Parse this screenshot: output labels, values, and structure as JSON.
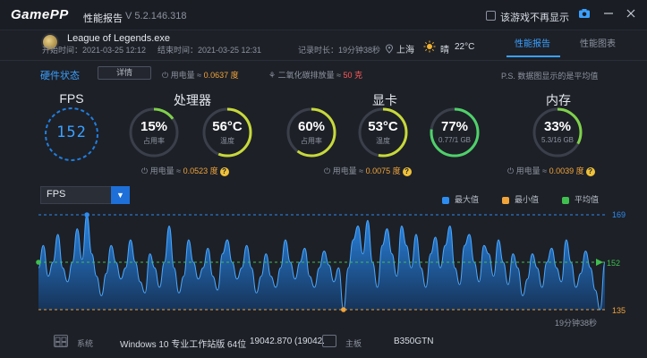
{
  "titlebar": {
    "logo": "GamePP",
    "title": "性能报告",
    "version": "V 5.2.146.318",
    "hide_checkbox_label": "该游戏不再显示"
  },
  "header": {
    "game_name": "League of Legends.exe",
    "start_time": "开始时间：2021-03-25 12:12",
    "end_time": "结束时间：2021-03-25 12:31",
    "duration": "记录时长：19分钟38秒",
    "city": "上海",
    "weather": "晴",
    "temperature": "22°C",
    "tabs": [
      {
        "label": "性能报告",
        "active": true
      },
      {
        "label": "性能图表",
        "active": false
      }
    ]
  },
  "hardware": {
    "status_label": "硬件状态",
    "detail_button": "详情",
    "power_prefix": "用电量 ≈ ",
    "power_value": "0.0637 度",
    "co2_prefix": "二氧化碳排放量 ≈ ",
    "co2_value": "50 克",
    "note": "P.S. 数据图显示的是平均值"
  },
  "fps": {
    "label": "FPS",
    "value": "152"
  },
  "cpu": {
    "label": "处理器",
    "gauges": [
      {
        "value": "15%",
        "sub": "占用率",
        "percent": 15,
        "color": "#7fd14a"
      },
      {
        "value": "56°C",
        "sub": "温度",
        "percent": 56,
        "color": "#c7d93a"
      }
    ],
    "power_prefix": "用电量 ≈ ",
    "power_value": "0.0523 度"
  },
  "gpu": {
    "label": "显卡",
    "gauges": [
      {
        "value": "60%",
        "sub": "占用率",
        "percent": 60,
        "color": "#c7d93a"
      },
      {
        "value": "53°C",
        "sub": "温度",
        "percent": 53,
        "color": "#c7d93a"
      },
      {
        "value": "77%",
        "sub": "0.77/1 GB",
        "percent": 77,
        "color": "#4fd16a"
      }
    ],
    "power_prefix": "用电量 ≈ ",
    "power_value": "0.0075 度"
  },
  "memory": {
    "label": "内存",
    "gauges": [
      {
        "value": "33%",
        "sub": "5.3/16 GB",
        "percent": 33,
        "color": "#7fd14a"
      }
    ],
    "power_prefix": "用电量 ≈ ",
    "power_value": "0.0039 度"
  },
  "chart": {
    "select_label": "FPS",
    "legend": [
      {
        "label": "最大值",
        "color": "#2d8cf0"
      },
      {
        "label": "最小值",
        "color": "#f0a43a"
      },
      {
        "label": "平均值",
        "color": "#3fbf4f"
      }
    ],
    "max_label": "169",
    "avg_label": "152",
    "min_label": "135",
    "duration_label": "19分钟38秒"
  },
  "chart_data": {
    "type": "area",
    "title": "",
    "ylim": [
      135,
      169
    ],
    "max": 169,
    "avg": 152,
    "min": 135,
    "values": [
      150,
      158,
      147,
      152,
      162,
      150,
      145,
      152,
      164,
      153,
      169,
      155,
      147,
      140,
      148,
      158,
      152,
      146,
      150,
      160,
      152,
      145,
      141,
      155,
      150,
      143,
      152,
      165,
      150,
      141,
      147,
      160,
      152,
      146,
      150,
      157,
      147,
      142,
      155,
      160,
      152,
      146,
      150,
      158,
      150,
      141,
      147,
      155,
      147,
      143,
      150,
      160,
      152,
      146,
      152,
      157,
      147,
      143,
      150,
      156,
      151,
      145,
      150,
      135,
      150,
      160,
      165,
      155,
      167,
      152,
      143,
      158,
      164,
      155,
      147,
      165,
      158,
      150,
      162,
      150,
      143,
      155,
      161,
      150,
      158,
      165,
      150,
      144,
      158,
      162,
      152,
      145,
      158,
      155,
      147,
      160,
      152,
      144,
      155,
      150,
      140,
      146,
      155,
      150,
      143,
      152,
      157,
      150,
      145,
      160,
      152,
      143,
      148,
      156,
      150,
      142,
      135,
      152
    ]
  },
  "bottom": {
    "system_label": "系统",
    "system_value": "Windows 10 专业工作站版 64位",
    "build_value": "19042.870 (19042.",
    "board_label": "主板",
    "board_value": "B350GTN"
  }
}
